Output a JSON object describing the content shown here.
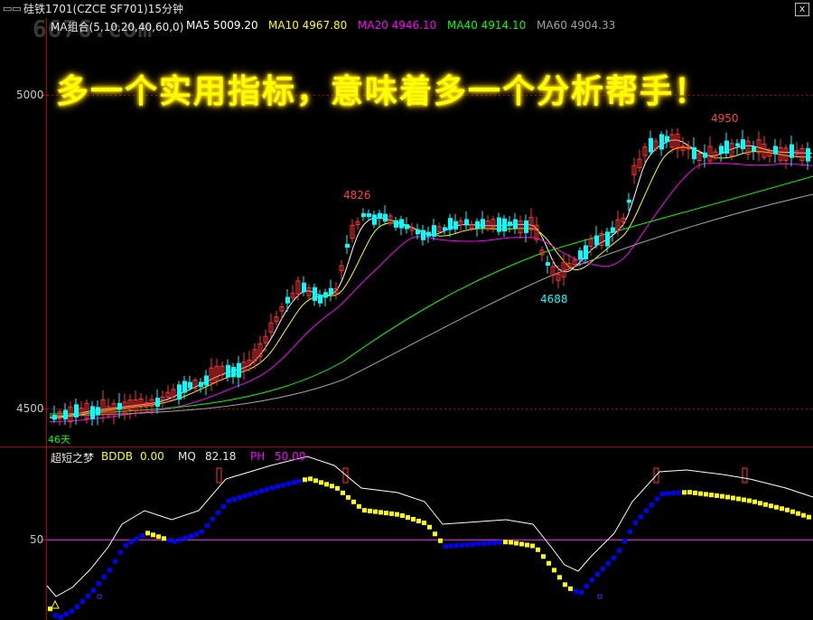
{
  "window": {
    "sys_icon": "▭▭",
    "title": "硅铁1701(CZCE SF701)15分钟",
    "close_glyph": "x"
  },
  "watermark": "6676.com",
  "slogan": "多一个实用指标，意味着多一个分析帮手！",
  "ma_legend": [
    {
      "text": "MA组合(5,10,20,40,60,0)",
      "color": "#e8e8e8"
    },
    {
      "text": "MA5 5009.20",
      "color": "#ffffff"
    },
    {
      "text": "MA10 4967.80",
      "color": "#ffff00"
    },
    {
      "text": "MA20 4946.10",
      "color": "#ff00ff"
    },
    {
      "text": "MA40 4914.10",
      "color": "#00ff00"
    },
    {
      "text": "MA60 4904.33",
      "color": "#a0a0a0"
    }
  ],
  "price_axis": {
    "labels": [
      "5000",
      "4500"
    ]
  },
  "price_annotations": {
    "high_left": "4826",
    "low": "4688",
    "high_right": "4950",
    "days": "46天"
  },
  "indicator": {
    "name": "超短之梦",
    "legend": [
      {
        "text": "超短之梦",
        "color": "#e8e8e8"
      },
      {
        "text": "BDDB",
        "color": "#ffff00"
      },
      {
        "text": "0.00",
        "color": "#ffff00"
      },
      {
        "text": "MQ",
        "color": "#e8e8e8"
      },
      {
        "text": "82.18",
        "color": "#e8e8e8"
      },
      {
        "text": "PH",
        "color": "#ff00ff"
      },
      {
        "text": "50.00",
        "color": "#ff00ff"
      }
    ],
    "axis_label": "50"
  },
  "colors": {
    "up_candle": "#ff3232",
    "down_candle": "#00ffff",
    "ma5": "#ffffff",
    "ma10": "#ffff00",
    "ma20": "#ff00ff",
    "ma40": "#00ff00",
    "ma60": "#a0a0a0",
    "grid_dashed": "#b00000",
    "ind_line_ph": "#ff00ff",
    "bar_blue": "#0000ff",
    "bar_yellow": "#ffff00"
  }
}
